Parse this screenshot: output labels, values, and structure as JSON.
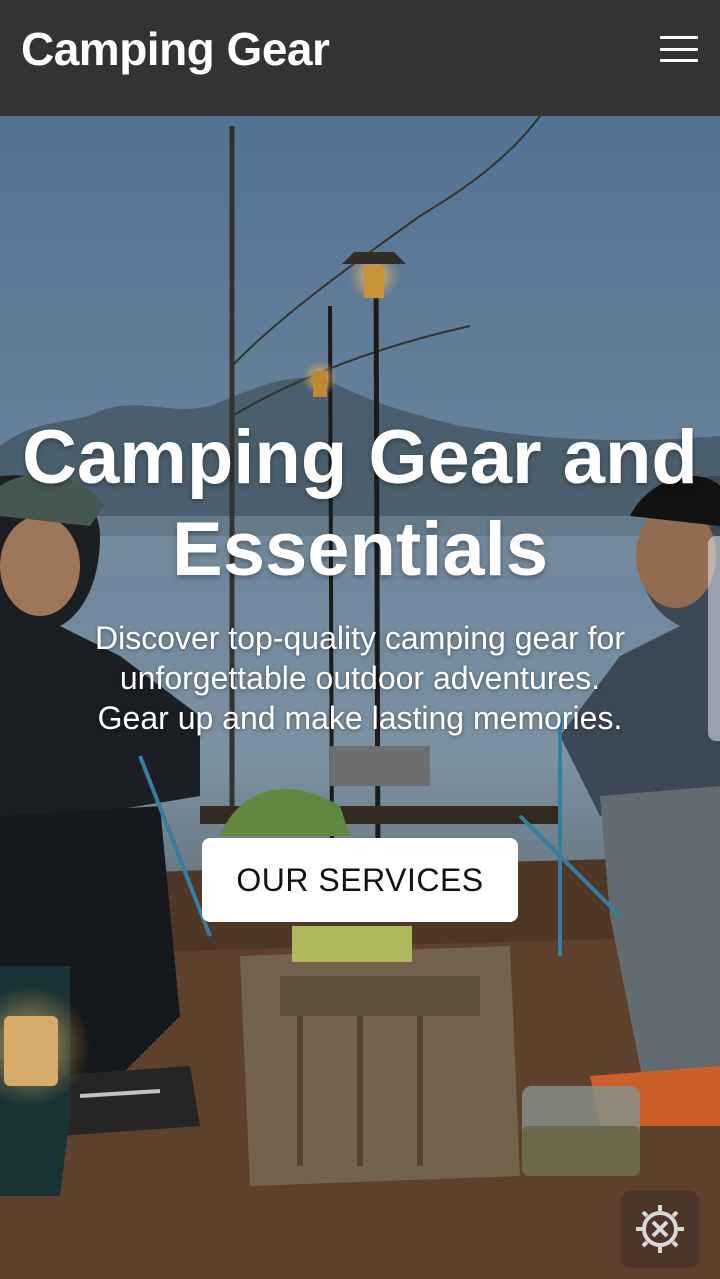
{
  "header": {
    "site_title": "Camping Gear",
    "menu_icon": "hamburger-menu-icon"
  },
  "hero": {
    "title_line1": "Camping Gear and",
    "title_line2": "Essentials",
    "subtitle_line1": "Discover top-quality camping gear for",
    "subtitle_line2": "unforgettable outdoor adventures.",
    "subtitle_line3": "Gear up and make lasting memories.",
    "cta_label": "OUR SERVICES"
  },
  "widgets": {
    "settings_icon": "gear-settings-icon"
  },
  "colors": {
    "header_bg": "#333333",
    "text": "#ffffff",
    "button_bg": "#ffffff",
    "button_text": "#111111"
  }
}
